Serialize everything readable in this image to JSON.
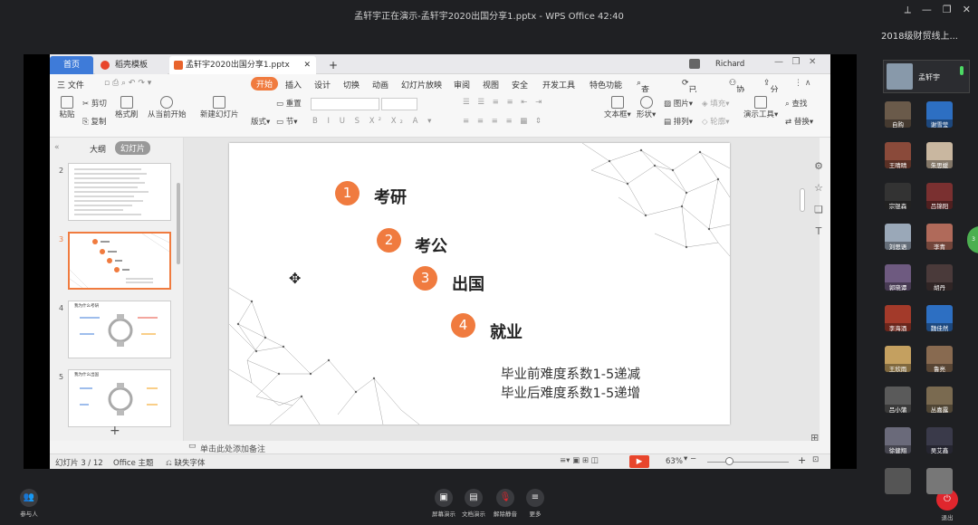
{
  "window": {
    "title": "孟轩宇正在演示-孟轩宇2020出国分享1.pptx - WPS Office 42:40"
  },
  "wps": {
    "tabs": [
      {
        "label": "首页"
      },
      {
        "label": "稻壳模板"
      },
      {
        "label": "孟轩宇2020出国分享1.pptx"
      }
    ],
    "user": "Richard",
    "menu": [
      "三 文件",
      "开始",
      "插入",
      "设计",
      "切换",
      "动画",
      "幻灯片放映",
      "审阅",
      "视图",
      "安全",
      "开发工具",
      "特色功能",
      "查找",
      "已同步",
      "协作",
      "分享"
    ],
    "ribbon": {
      "paste": "粘贴",
      "cut": "剪切",
      "copy": "复制",
      "format_painter": "格式刷",
      "play_from_current": "从当前开始",
      "new_slide": "新建幻灯片",
      "layout": "版式",
      "section": "节",
      "reset": "重置",
      "textbox": "文本框",
      "shape": "形状",
      "picture": "图片",
      "arrange": "排列",
      "fill": "填充",
      "outline": "轮廓",
      "present_tools": "演示工具",
      "find": "查找",
      "replace": "替换"
    },
    "left_panel": {
      "tab_outline": "大纲",
      "tab_slides": "幻灯片",
      "slide_numbers": [
        "2",
        "3",
        "4",
        "5"
      ],
      "thumb4_title": "我为什么考研",
      "thumb5_title": "我为什么出国"
    },
    "slide": {
      "items": [
        {
          "num": "1",
          "label": "考研"
        },
        {
          "num": "2",
          "label": "考公"
        },
        {
          "num": "3",
          "label": "出国"
        },
        {
          "num": "4",
          "label": "就业"
        }
      ],
      "note1": "毕业前难度系数1-5递减",
      "note2": "毕业后难度系数1-5递增"
    },
    "notes_placeholder": "单击此处添加备注",
    "status": {
      "slide_count": "幻灯片 3 / 12",
      "theme": "Office 主题",
      "missing_font": "缺失字体",
      "zoom": "63%"
    }
  },
  "participants": {
    "header": "2018级财贸线上...",
    "presenter": "孟轩宇",
    "list": [
      "自购",
      "谢雪莹",
      "王晴晴",
      "朱思媛",
      "宗锟森",
      "吕锦阳",
      "刘思语",
      "李青",
      "郭晓谭",
      "胡丹",
      "李海酒",
      "魏佳然",
      "王欣雨",
      "鲁亮",
      "吕小蒲",
      "丛嘉露",
      "徐健翔",
      "吴艾鑫",
      "",
      ""
    ]
  },
  "bottom": {
    "participants_btn": "参与人",
    "share_screen": "屏幕演示",
    "doc_present": "文档演示",
    "unmute": "解除静音",
    "more": "更多",
    "leave": "退出"
  },
  "colors": {
    "accent_orange": "#f07b3f",
    "leave_red": "#e0262d",
    "ribbon_start": "#f07b3f"
  }
}
